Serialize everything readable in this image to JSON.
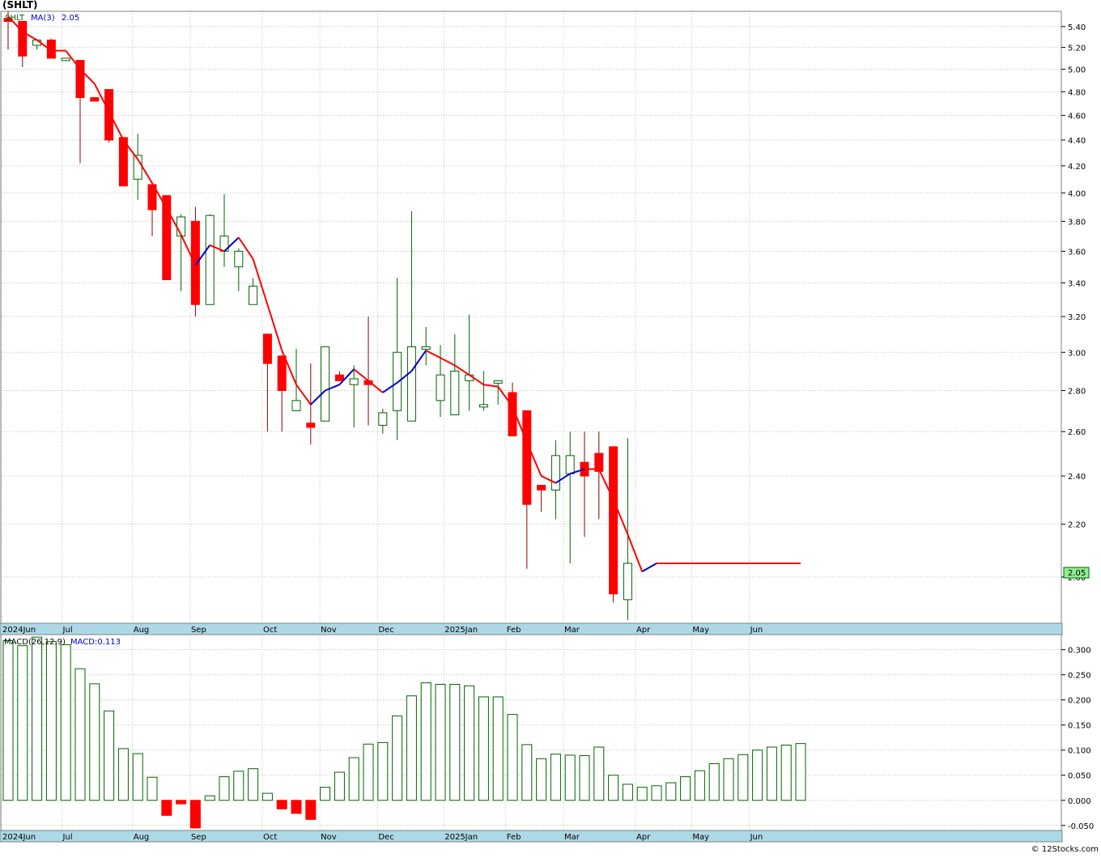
{
  "ticker_title": "(SHLT)",
  "price_legend": {
    "symbol": "SHLT",
    "ma_label": "MA(3)",
    "ma_value": "2.05"
  },
  "macd_legend": {
    "label": "MACD(26,12,9)",
    "value_label": "MACD:0.113"
  },
  "last_price_tag": "2.05",
  "copyright": "© 12Stocks.com",
  "colors": {
    "up": "#006400",
    "down": "#ff0000",
    "ma_up": "#0000cc",
    "ma_down": "#ff0000",
    "macd": "#006400",
    "axis_strip": "#add8e6",
    "grid": "#c0c0c0",
    "price_tag": "#90ee90"
  },
  "chart_data": [
    {
      "type": "candlestick",
      "name": "SHLT",
      "scale": "log",
      "ylim": [
        1.84,
        5.55
      ],
      "y_ticks": [
        2.0,
        2.2,
        2.4,
        2.6,
        2.8,
        3.0,
        3.2,
        3.4,
        3.6,
        3.8,
        4.0,
        4.2,
        4.4,
        4.6,
        4.8,
        5.0,
        5.2,
        5.4
      ],
      "y_tick_labels": [
        "2.00",
        "2.20",
        "2.40",
        "2.60",
        "2.80",
        "3.00",
        "3.20",
        "3.40",
        "3.60",
        "3.80",
        "4.00",
        "4.20",
        "4.40",
        "4.60",
        "4.80",
        "5.00",
        "5.20",
        "5.40"
      ],
      "x_month_labels": [
        "2024Jun",
        "Jul",
        "Aug",
        "Sep",
        "Oct",
        "Nov",
        "Dec",
        "2025Jan",
        "Feb",
        "Mar",
        "Apr",
        "May",
        "Jun"
      ],
      "x_month_weeks": [
        0,
        4.3,
        9.2,
        13.2,
        18.2,
        22.2,
        26.2,
        30.8,
        35.1,
        39.1,
        44.1,
        48,
        52
      ],
      "bars": [
        {
          "week": 0,
          "o": 5.48,
          "h": 5.55,
          "l": 5.18,
          "c": 5.45
        },
        {
          "week": 1,
          "o": 5.45,
          "h": 5.45,
          "l": 5.02,
          "c": 5.12
        },
        {
          "week": 2,
          "o": 5.22,
          "h": 5.28,
          "l": 5.18,
          "c": 5.27
        },
        {
          "week": 3,
          "o": 5.27,
          "h": 5.28,
          "l": 5.1,
          "c": 5.1
        },
        {
          "week": 4,
          "o": 5.1,
          "h": 5.1,
          "l": 5.1,
          "c": 5.1
        },
        {
          "week": 5,
          "o": 5.08,
          "h": 5.08,
          "l": 4.22,
          "c": 4.75
        },
        {
          "week": 6,
          "o": 4.75,
          "h": 4.75,
          "l": 4.72,
          "c": 4.72
        },
        {
          "week": 7,
          "o": 4.82,
          "h": 4.82,
          "l": 4.38,
          "c": 4.4
        },
        {
          "week": 8,
          "o": 4.42,
          "h": 4.42,
          "l": 4.05,
          "c": 4.05
        },
        {
          "week": 9,
          "o": 4.1,
          "h": 4.45,
          "l": 3.95,
          "c": 4.28
        },
        {
          "week": 10,
          "o": 4.06,
          "h": 4.06,
          "l": 3.7,
          "c": 3.88
        },
        {
          "week": 11,
          "o": 3.98,
          "h": 3.98,
          "l": 3.42,
          "c": 3.42
        },
        {
          "week": 12,
          "o": 3.7,
          "h": 3.85,
          "l": 3.35,
          "c": 3.83
        },
        {
          "week": 13,
          "o": 3.8,
          "h": 3.9,
          "l": 3.2,
          "c": 3.27
        },
        {
          "week": 14,
          "o": 3.27,
          "h": 3.85,
          "l": 3.27,
          "c": 3.84
        },
        {
          "week": 15,
          "o": 3.6,
          "h": 3.99,
          "l": 3.5,
          "c": 3.7
        },
        {
          "week": 16,
          "o": 3.5,
          "h": 3.62,
          "l": 3.35,
          "c": 3.6
        },
        {
          "week": 17,
          "o": 3.27,
          "h": 3.43,
          "l": 3.27,
          "c": 3.38
        },
        {
          "week": 18,
          "o": 3.1,
          "h": 3.1,
          "l": 2.6,
          "c": 2.94
        },
        {
          "week": 19,
          "o": 2.98,
          "h": 2.98,
          "l": 2.6,
          "c": 2.8
        },
        {
          "week": 20,
          "o": 2.7,
          "h": 3.02,
          "l": 2.7,
          "c": 2.75
        },
        {
          "week": 21,
          "o": 2.64,
          "h": 2.94,
          "l": 2.54,
          "c": 2.62
        },
        {
          "week": 22,
          "o": 2.65,
          "h": 3.03,
          "l": 2.65,
          "c": 3.03
        },
        {
          "week": 23,
          "o": 2.88,
          "h": 2.9,
          "l": 2.85,
          "c": 2.85
        },
        {
          "week": 24,
          "o": 2.83,
          "h": 2.93,
          "l": 2.62,
          "c": 2.86
        },
        {
          "week": 25,
          "o": 2.85,
          "h": 3.2,
          "l": 2.63,
          "c": 2.83
        },
        {
          "week": 26,
          "o": 2.63,
          "h": 2.71,
          "l": 2.59,
          "c": 2.69
        },
        {
          "week": 27,
          "o": 2.7,
          "h": 3.43,
          "l": 2.56,
          "c": 3.0
        },
        {
          "week": 28,
          "o": 2.65,
          "h": 3.87,
          "l": 2.65,
          "c": 3.03
        },
        {
          "week": 29,
          "o": 3.02,
          "h": 3.14,
          "l": 2.93,
          "c": 3.03
        },
        {
          "week": 30,
          "o": 2.75,
          "h": 3.04,
          "l": 2.67,
          "c": 2.88
        },
        {
          "week": 31,
          "o": 2.68,
          "h": 3.1,
          "l": 2.68,
          "c": 2.9
        },
        {
          "week": 32,
          "o": 2.85,
          "h": 3.21,
          "l": 2.7,
          "c": 2.88
        },
        {
          "week": 33,
          "o": 2.72,
          "h": 2.9,
          "l": 2.7,
          "c": 2.73
        },
        {
          "week": 34,
          "o": 2.84,
          "h": 2.85,
          "l": 2.73,
          "c": 2.85
        },
        {
          "week": 35,
          "o": 2.79,
          "h": 2.84,
          "l": 2.58,
          "c": 2.58
        },
        {
          "week": 36,
          "o": 2.7,
          "h": 2.7,
          "l": 2.03,
          "c": 2.28
        },
        {
          "week": 37,
          "o": 2.36,
          "h": 2.36,
          "l": 2.25,
          "c": 2.34
        },
        {
          "week": 38,
          "o": 2.34,
          "h": 2.56,
          "l": 2.22,
          "c": 2.49
        },
        {
          "week": 39,
          "o": 2.41,
          "h": 2.6,
          "l": 2.05,
          "c": 2.49
        },
        {
          "week": 40,
          "o": 2.46,
          "h": 2.6,
          "l": 2.15,
          "c": 2.4
        },
        {
          "week": 41,
          "o": 2.5,
          "h": 2.6,
          "l": 2.22,
          "c": 2.42
        },
        {
          "week": 42,
          "o": 2.53,
          "h": 2.53,
          "l": 1.91,
          "c": 1.94
        },
        {
          "week": 43,
          "o": 1.92,
          "h": 2.57,
          "l": 1.85,
          "c": 2.05
        }
      ],
      "ma": [
        {
          "week": 0,
          "v": 5.5
        },
        {
          "week": 1,
          "v": 5.35
        },
        {
          "week": 2,
          "v": 5.27
        },
        {
          "week": 3,
          "v": 5.17
        },
        {
          "week": 4,
          "v": 5.17
        },
        {
          "week": 5,
          "v": 5.0
        },
        {
          "week": 6,
          "v": 4.87
        },
        {
          "week": 7,
          "v": 4.63
        },
        {
          "week": 8,
          "v": 4.4
        },
        {
          "week": 9,
          "v": 4.25
        },
        {
          "week": 10,
          "v": 4.07
        },
        {
          "week": 11,
          "v": 3.89
        },
        {
          "week": 12,
          "v": 3.71
        },
        {
          "week": 13,
          "v": 3.51
        },
        {
          "week": 14,
          "v": 3.64
        },
        {
          "week": 15,
          "v": 3.6
        },
        {
          "week": 16,
          "v": 3.69
        },
        {
          "week": 17,
          "v": 3.55
        },
        {
          "week": 18,
          "v": 3.27
        },
        {
          "week": 19,
          "v": 3.01
        },
        {
          "week": 20,
          "v": 2.83
        },
        {
          "week": 21,
          "v": 2.73
        },
        {
          "week": 22,
          "v": 2.8
        },
        {
          "week": 23,
          "v": 2.83
        },
        {
          "week": 24,
          "v": 2.91
        },
        {
          "week": 25,
          "v": 2.85
        },
        {
          "week": 26,
          "v": 2.79
        },
        {
          "week": 27,
          "v": 2.84
        },
        {
          "week": 28,
          "v": 2.9
        },
        {
          "week": 29,
          "v": 3.01
        },
        {
          "week": 30,
          "v": 2.97
        },
        {
          "week": 31,
          "v": 2.93
        },
        {
          "week": 32,
          "v": 2.88
        },
        {
          "week": 33,
          "v": 2.83
        },
        {
          "week": 34,
          "v": 2.82
        },
        {
          "week": 35,
          "v": 2.72
        },
        {
          "week": 36,
          "v": 2.55
        },
        {
          "week": 37,
          "v": 2.4
        },
        {
          "week": 38,
          "v": 2.37
        },
        {
          "week": 39,
          "v": 2.41
        },
        {
          "week": 40,
          "v": 2.43
        },
        {
          "week": 41,
          "v": 2.43
        },
        {
          "week": 42,
          "v": 2.3
        },
        {
          "week": 43,
          "v": 2.16
        },
        {
          "week": 44,
          "v": 2.02
        },
        {
          "week": 45,
          "v": 2.05
        },
        {
          "week": 55,
          "v": 2.05
        }
      ]
    },
    {
      "type": "bar",
      "name": "MACD(26,12,9)",
      "ylim": [
        -0.06,
        0.33
      ],
      "y_ticks": [
        -0.05,
        0.0,
        0.05,
        0.1,
        0.15,
        0.2,
        0.25,
        0.3
      ],
      "y_tick_labels": [
        "-0.050",
        "0.000",
        "0.050",
        "0.100",
        "0.150",
        "0.200",
        "0.250",
        "0.300"
      ],
      "x_month_labels": [
        "2024Jun",
        "Jul",
        "Aug",
        "Sep",
        "Oct",
        "Nov",
        "Dec",
        "2025Jan",
        "Feb",
        "Mar",
        "Apr",
        "May",
        "Jun"
      ],
      "bars": [
        {
          "week": 0,
          "v": 0.318
        },
        {
          "week": 1,
          "v": 0.308
        },
        {
          "week": 2,
          "v": 0.325
        },
        {
          "week": 3,
          "v": 0.316
        },
        {
          "week": 4,
          "v": 0.31
        },
        {
          "week": 5,
          "v": 0.262
        },
        {
          "week": 6,
          "v": 0.232
        },
        {
          "week": 7,
          "v": 0.178
        },
        {
          "week": 8,
          "v": 0.103
        },
        {
          "week": 9,
          "v": 0.093
        },
        {
          "week": 10,
          "v": 0.046
        },
        {
          "week": 11,
          "v": -0.03
        },
        {
          "week": 12,
          "v": -0.007
        },
        {
          "week": 13,
          "v": -0.055
        },
        {
          "week": 14,
          "v": 0.009
        },
        {
          "week": 15,
          "v": 0.047
        },
        {
          "week": 16,
          "v": 0.058
        },
        {
          "week": 17,
          "v": 0.063
        },
        {
          "week": 18,
          "v": 0.014
        },
        {
          "week": 19,
          "v": -0.017
        },
        {
          "week": 20,
          "v": -0.026
        },
        {
          "week": 21,
          "v": -0.038
        },
        {
          "week": 22,
          "v": 0.026
        },
        {
          "week": 23,
          "v": 0.056
        },
        {
          "week": 24,
          "v": 0.085
        },
        {
          "week": 25,
          "v": 0.112
        },
        {
          "week": 26,
          "v": 0.115
        },
        {
          "week": 27,
          "v": 0.168
        },
        {
          "week": 28,
          "v": 0.208
        },
        {
          "week": 29,
          "v": 0.234
        },
        {
          "week": 30,
          "v": 0.231
        },
        {
          "week": 31,
          "v": 0.231
        },
        {
          "week": 32,
          "v": 0.228
        },
        {
          "week": 33,
          "v": 0.206
        },
        {
          "week": 34,
          "v": 0.206
        },
        {
          "week": 35,
          "v": 0.171
        },
        {
          "week": 36,
          "v": 0.111
        },
        {
          "week": 37,
          "v": 0.083
        },
        {
          "week": 38,
          "v": 0.092
        },
        {
          "week": 39,
          "v": 0.09
        },
        {
          "week": 40,
          "v": 0.089
        },
        {
          "week": 41,
          "v": 0.106
        },
        {
          "week": 42,
          "v": 0.05
        },
        {
          "week": 43,
          "v": 0.032
        },
        {
          "week": 44,
          "v": 0.026
        },
        {
          "week": 45,
          "v": 0.029
        },
        {
          "week": 46,
          "v": 0.035
        },
        {
          "week": 47,
          "v": 0.047
        },
        {
          "week": 48,
          "v": 0.059
        },
        {
          "week": 49,
          "v": 0.073
        },
        {
          "week": 50,
          "v": 0.083
        },
        {
          "week": 51,
          "v": 0.091
        },
        {
          "week": 52,
          "v": 0.1
        },
        {
          "week": 53,
          "v": 0.106
        },
        {
          "week": 54,
          "v": 0.11
        },
        {
          "week": 55,
          "v": 0.113
        }
      ]
    }
  ]
}
